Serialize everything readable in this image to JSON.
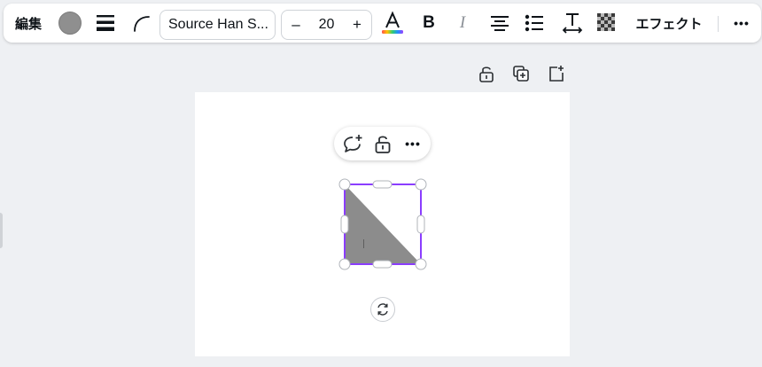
{
  "toolbar": {
    "edit_label": "編集",
    "fill_color": "#8f8f8f",
    "border_style_icon": "border-style-icon",
    "corner_icon": "corner-rounding-icon",
    "font_name": "Source Han S...",
    "font_size": {
      "minus": "–",
      "value": "20",
      "plus": "+"
    },
    "text_color_letter": "A",
    "bold_label": "B",
    "italic_label": "I",
    "align_icon": "align-center-icon",
    "list_icon": "list-icon",
    "spacing_icon": "letter-spacing-icon",
    "transparency_icon": "transparency-icon",
    "effects_label": "エフェクト",
    "more_label": "•••"
  },
  "page_actions": {
    "icons": [
      "unlock-icon",
      "duplicate-page-icon",
      "add-page-icon"
    ]
  },
  "context_menu": {
    "icons": [
      "comment-add-icon",
      "unlock-icon",
      "more-icon"
    ],
    "more_label": "•••"
  },
  "shape": {
    "type": "right-triangle",
    "fill": "#8c8c8c",
    "selection_color": "#8b3dff"
  },
  "rotate_icon": "rotate-icon"
}
